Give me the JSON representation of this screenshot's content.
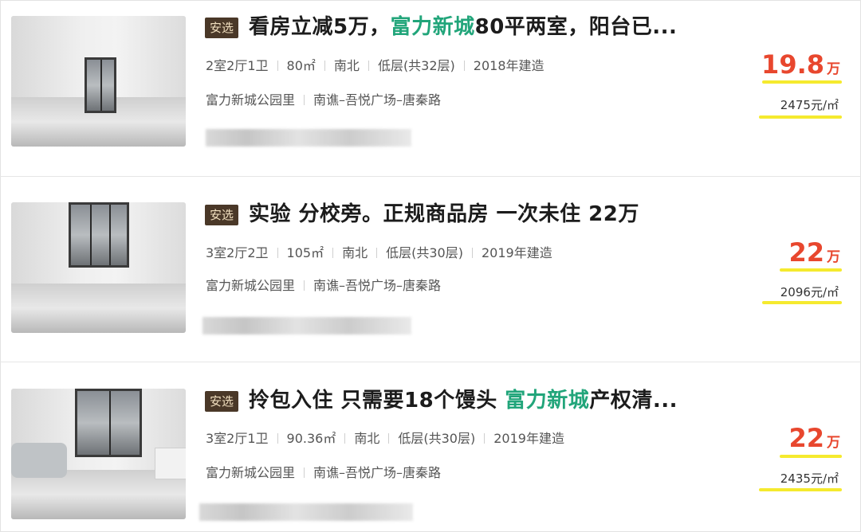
{
  "listings": [
    {
      "badge": "安选",
      "title_pre": "看房立减5万，",
      "title_hl": "富力新城",
      "title_post": "80平两室，阳台已...",
      "layout": "2室2厅1卫",
      "area": "80㎡",
      "orientation": "南北",
      "floor": "低层(共32层)",
      "year": "2018年建造",
      "community": "富力新城公园里",
      "district": "南谯–吾悦广场–唐秦路",
      "price": "19.8",
      "price_unit": "万",
      "unit_price": "2475元/㎡"
    },
    {
      "badge": "安选",
      "title_pre": "实验 分校旁。正规商品房 一次未住 22万",
      "title_hl": "",
      "title_post": "",
      "layout": "3室2厅2卫",
      "area": "105㎡",
      "orientation": "南北",
      "floor": "低层(共30层)",
      "year": "2019年建造",
      "community": "富力新城公园里",
      "district": "南谯–吾悦广场–唐秦路",
      "price": "22",
      "price_unit": "万",
      "unit_price": "2096元/㎡"
    },
    {
      "badge": "安选",
      "title_pre": "拎包入住 只需要18个馒头 ",
      "title_hl": "富力新城",
      "title_post": "产权清...",
      "layout": "3室2厅1卫",
      "area": "90.36㎡",
      "orientation": "南北",
      "floor": "低层(共30层)",
      "year": "2019年建造",
      "community": "富力新城公园里",
      "district": "南谯–吾悦广场–唐秦路",
      "price": "22",
      "price_unit": "万",
      "unit_price": "2435元/㎡"
    }
  ],
  "colors": {
    "highlight": "#21a57a",
    "price": "#e8472e",
    "badge_bg": "#4a3828",
    "marker": "#f5ea2e"
  }
}
